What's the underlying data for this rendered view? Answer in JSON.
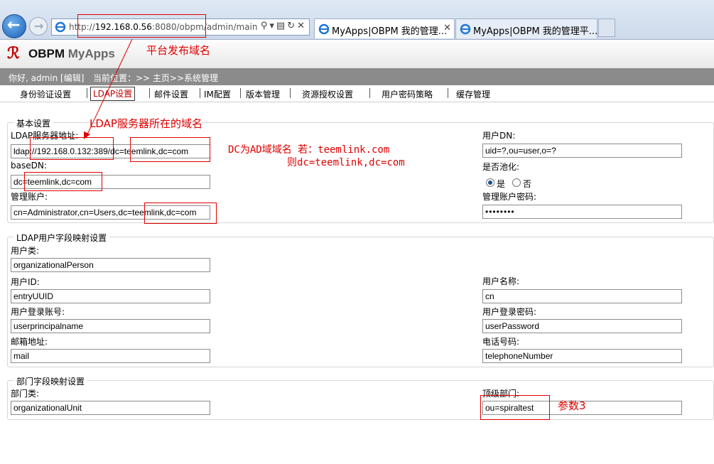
{
  "browser": {
    "url_prefix": "http://",
    "url_host": "192.168.0.56",
    "url_rest": ":8080/obpm/admin/main",
    "tabs": [
      {
        "title": "MyApps|OBPM 我的管理..."
      },
      {
        "title": "MyApps|OBPM 我的管理平..."
      }
    ],
    "icons": [
      "back-icon",
      "forward-icon",
      "search-icon",
      "dropdown-icon",
      "compat-icon",
      "refresh-icon",
      "close-icon",
      "ie-icon"
    ]
  },
  "app": {
    "logo_obpm": "OBPM",
    "logo_myapps": "MyApps",
    "greeting": "你好, admin [编辑]",
    "location": "当前位置：>> 主页>>系统管理"
  },
  "menu": [
    "身份验证设置",
    "LDAP设置",
    "邮件设置",
    "IM配置",
    "版本管理",
    "资源授权设置",
    "用户密码策略",
    "缓存管理"
  ],
  "sections": {
    "basic": {
      "legend": "基本设置",
      "ldap_server_label": "LDAP服务器地址:",
      "ldap_server_value": "ldap://192.168.0.132:389/dc=teemlink,dc=com",
      "basedn_label": "baseDN:",
      "basedn_value": "dc=teemlink,dc=com",
      "admin_label": "管理账户:",
      "admin_value": "cn=Administrator,cn=Users,dc=teemlink,dc=com",
      "userdn_label": "用户DN:",
      "userdn_value": "uid=?,ou=user,o=?",
      "pool_label": "是否池化:",
      "pool_yes": "是",
      "pool_no": "否",
      "pool_selected": "是",
      "admin_pwd_label": "管理账户密码:",
      "admin_pwd_value": "••••••••"
    },
    "user_mapping": {
      "legend": "LDAP用户字段映射设置",
      "user_class_label": "用户类:",
      "user_class_value": "organizationalPerson",
      "user_id_label": "用户ID:",
      "user_id_value": "entryUUID",
      "user_name_label": "用户名称:",
      "user_name_value": "cn",
      "login_acct_label": "用户登录账号:",
      "login_acct_value": "userprincipalname",
      "login_pwd_label": "用户登录密码:",
      "login_pwd_value": "userPassword",
      "email_label": "邮箱地址:",
      "email_value": "mail",
      "phone_label": "电话号码:",
      "phone_value": "telephoneNumber"
    },
    "dept_mapping": {
      "legend": "部门字段映射设置",
      "dept_class_label": "部门类:",
      "dept_class_value": "organizationalUnit",
      "top_dept_label": "顶级部门:",
      "top_dept_value": "ou=spiraltest"
    }
  },
  "annotations": {
    "platform_domain": "平台发布域名",
    "ldap_domain": "LDAP服务器所在的域名",
    "dc_line1": "DC为AD域域名 若：teemlink.com",
    "dc_line2": "则dc=teemlink,dc=com",
    "param3": "参数3",
    "color": "#e00000"
  }
}
